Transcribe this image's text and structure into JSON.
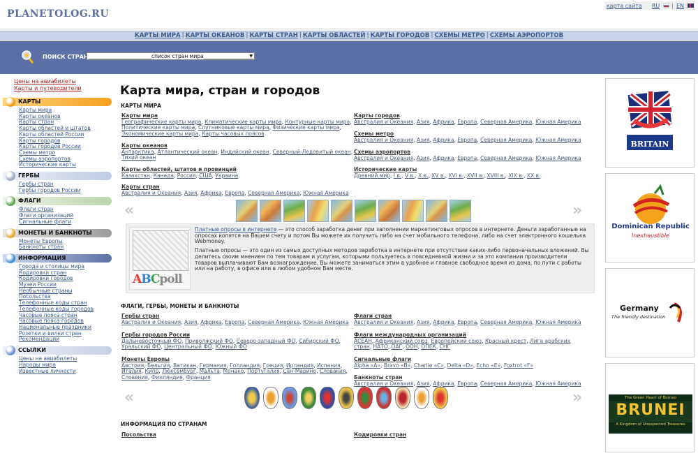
{
  "header": {
    "logo": "PLANETOLOG.RU",
    "sitemap_label": "карта сайта",
    "lang_ru": "RU",
    "lang_en": "EN",
    "sep": "|"
  },
  "nav": {
    "items": [
      "КАРТЫ МИРА",
      "КАРТЫ ОКЕАНОВ",
      "КАРТЫ СТРАН",
      "КАРТЫ ОБЛАСТЕЙ",
      "КАРТЫ ГОРОДОВ",
      "СХЕМЫ МЕТРО",
      "СХЕМЫ АЭРОПОРТОВ"
    ],
    "sep": "|"
  },
  "search": {
    "label": "ПОИСК СТРАН:",
    "selected": "________________________список стран мира_________________________"
  },
  "sidebar": {
    "toplinks": [
      "Цены на авиабилеты",
      "Карты и путеводители"
    ],
    "sections": [
      {
        "title": "КАРТЫ",
        "links": [
          "Карты мира",
          "Карты океанов",
          "Карты стран",
          "Карты областей и штатов",
          "Карты областей России",
          "Карты городов",
          "Карты городов России",
          "Схемы метро",
          "Схемы аэропортов",
          "Исторические карты"
        ]
      },
      {
        "title": "ГЕРБЫ",
        "links": [
          "Гербы стран",
          "Гербы городов России"
        ]
      },
      {
        "title": "ФЛАГИ",
        "links": [
          "Флаги стран",
          "Флаги организаций",
          "Сигнальные флаги"
        ]
      },
      {
        "title": "МОНЕТЫ И БАНКНОТЫ",
        "links": [
          "Монеты Европы",
          "Банкноты стран"
        ]
      },
      {
        "title": "ИНФОРМАЦИЯ",
        "links": [
          "Города и столицы мира",
          "Кодировки стран",
          "Кодировки городов",
          "Музеи России",
          "Необычные страны",
          "Посольства",
          "Телефонные коды стран",
          "Телефонные коды городов",
          "Часовые пояса стран",
          "Часовые пояса городов",
          "Национальные праздники",
          "Розетки и вилки стран",
          "Рекомендации"
        ]
      },
      {
        "title": "ССЫЛКИ",
        "links": [
          "Цены на авиабилеты",
          "Народы мира",
          "Известные личности"
        ]
      }
    ]
  },
  "main": {
    "title": "Карта мира, стран и городов",
    "maps_heading": "КАРТЫ МИРА",
    "maps_left": [
      {
        "title": "Карты мира",
        "items": [
          "Географические карты мира",
          "Климатические карты мира",
          "Контурные карты мира",
          "Политические карты мира",
          "Спутниковые карты мира",
          "Физические карты мира",
          "Экономические карты мира",
          "Карты часовых поясов"
        ]
      },
      {
        "title": "Карты океанов",
        "items": [
          "Антарктика",
          "Атлантический океан",
          "Индийский океан",
          "Северный-Ледовитый океан",
          "Тихий океан"
        ]
      },
      {
        "title": "Карты областей, штатов и провинций",
        "items": [
          "Казахстан",
          "Канада",
          "Россия",
          "США",
          "Украина"
        ]
      },
      {
        "title": "Карты стран",
        "items": [
          "Австралия и Океания",
          "Азия",
          "Африка",
          "Европа",
          "Северная Америка",
          "Южная Америка"
        ]
      }
    ],
    "maps_right": [
      {
        "title": "Карты городов",
        "items": [
          "Австралия и Океания",
          "Азия",
          "Африка",
          "Европа",
          "Северная Америка",
          "Южная Америка"
        ]
      },
      {
        "title": "Схемы метро",
        "items": [
          "Австралия и Океания",
          "Азия",
          "Африка",
          "Европа",
          "Северная Америка",
          "Южная Америка"
        ]
      },
      {
        "title": "Схемы аэропортов",
        "items": [
          "Австралия и Океания",
          "Азия",
          "Африка",
          "Европа",
          "Северная Америка",
          "Южная Америка"
        ]
      },
      {
        "title": "Исторические карты",
        "items": [
          "Древний мир",
          "I в.",
          "V в.",
          "X в.",
          "XV в.",
          "XVI в.",
          "XVII в.",
          "XVIII в.",
          "XIX в.",
          "XX в."
        ]
      }
    ],
    "carousel_prev": "«",
    "carousel_next": "»",
    "ad": {
      "link": "Платные опросы в интернете",
      "p1_rest": " — это способ заработка денег при заполнении маркетинговых опросов в интернете. Деньги заработанные на опросах копятся на Вашем счету и потом Вы можете их получить либо на счет мобильного телефона, либо на счет электронного кошелька Webmoney.",
      "p2": "Платные опросы — это один из самых доступных методов заработка в интернете при отсутствии каких-либо первоначальных вложений. Вы делитесь своим мнением по тем товарам и услугам, которыми пользуетесь в повседневной жизни и за это компании производители товаров выплачивают Вам вознаграждение. Вы можете заниматься этим в удобное и главное свободное время из дома, по пути с работы или на работу, в офисе или в любом удобном Вам месте.",
      "logo_text": "ABCpoll"
    },
    "flags_heading": "ФЛАГИ, ГЕРБЫ, МОНЕТЫ И БАНКНОТЫ",
    "flags_left": [
      {
        "title": "Гербы стран",
        "items": [
          "Австралия и Океания",
          "Азия",
          "Африка",
          "Европа",
          "Северная Америка",
          "Южная Америка"
        ]
      },
      {
        "title": "Гербы городов России",
        "items": [
          "Дальневосточный ФО",
          "Приволжский ФО",
          "Северо-западный ФО",
          "Сибирский ФО",
          "Уральский ФО",
          "Центральный ФО",
          "Южный ФО"
        ]
      },
      {
        "title": "Монеты Европы",
        "items": [
          "Австрия",
          "Бельгия",
          "Ватикан",
          "Германия",
          "Голландия",
          "Греция",
          "Ирландия",
          "Испания",
          "Италия",
          "Кипр",
          "Люксембург",
          "Мальта",
          "Монако",
          "Португалия",
          "Сан-Марино",
          "Словакия",
          "Словения",
          "Финляндия",
          "Франция"
        ]
      }
    ],
    "flags_right": [
      {
        "title": "Флаги стран",
        "items": [
          "Австралия и Океания",
          "Азия",
          "Африка",
          "Европа",
          "Северная Америка",
          "Южная Америка"
        ]
      },
      {
        "title": "Флаги международных организаций",
        "items": [
          "АСЕАН",
          "Африканский союз",
          "Европейский союз",
          "Красный крест",
          "Лига арабских стран",
          "НАТО",
          "ОАГ",
          "ООН",
          "ОПЕК",
          "СНГ"
        ]
      },
      {
        "title": "Сигнальные флаги",
        "items": [
          "Alpha «A»",
          "Bravo «B»",
          "Charlie «C»",
          "Delta «D»",
          "Echo «E»",
          "Foxtrot «F»"
        ]
      },
      {
        "title": "Банкноты стран",
        "items": [
          "Австралия и Океания",
          "Азия",
          "Африка",
          "Европа",
          "Северная Америка",
          "Южная Америка"
        ]
      }
    ],
    "info_heading": "ИНФОРМАЦИЯ ПО СТРАНАМ",
    "info_left_title": "Посольства",
    "info_right_title": "Кодировки стран"
  },
  "right_ads": [
    {
      "title": "BRITAIN"
    },
    {
      "title": "Dominican Republic",
      "subtitle": "Inexhaustible"
    },
    {
      "title": "Germany",
      "subtitle": "The friendly destination"
    },
    {
      "title": "BRUNEI",
      "top": "The Green Heart of Borneo",
      "subtitle": "A Kingdom of Unexpected Treasures"
    }
  ]
}
